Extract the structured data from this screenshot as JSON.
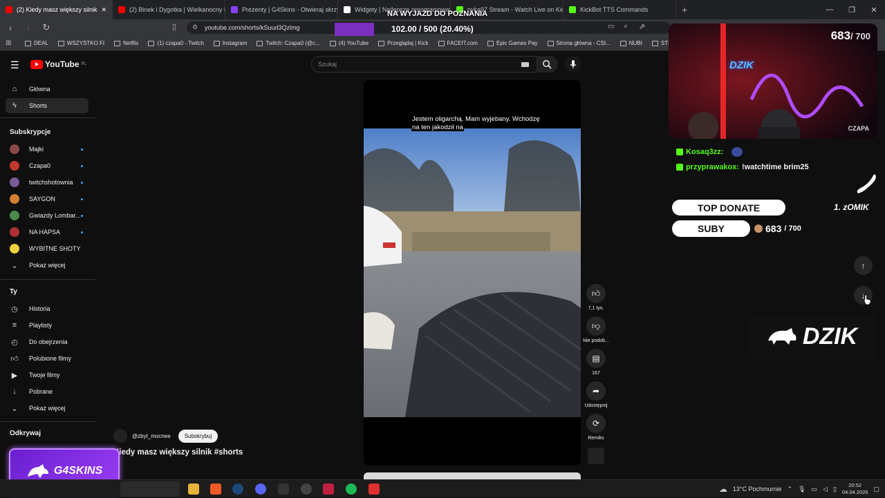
{
  "browser": {
    "tabs": [
      {
        "title": "(2) Kiedy masz większy silnik",
        "active": true,
        "color": "#ff0000"
      },
      {
        "title": "(2) Binek i Dygotka | Wielkanocny Ba",
        "color": "#ff0000"
      },
      {
        "title": "Prezenty | G4Skins - Otwieraj skrzynk",
        "color": "#8a3ffc"
      },
      {
        "title": "Widgety | Najlepsze oprogramowanie",
        "color": "#ffffff"
      },
      {
        "title": "pyka97 Stream - Watch Live on Kick",
        "color": "#53fc18"
      },
      {
        "title": "KickBot TTS Commands",
        "color": "#53fc18"
      }
    ],
    "url": "youtube.com/shorts/kSuud3Qzlmg",
    "bookmarks": [
      "DEAL",
      "WSZYSTKO FI",
      "Netflix",
      "(1) czapa0 - Twitch",
      "Instagram",
      "Twitch: Czapa0 (@c...",
      "(4) YouTube",
      "Przeglądaj | Kick",
      "FACEIT.com",
      "Epic Games Pay",
      "Strona główna - CSI...",
      "NUBI",
      "STRONY"
    ]
  },
  "youtube": {
    "logo": "YouTube",
    "logo_region": "PL",
    "search_placeholder": "Szukaj",
    "sidebar": {
      "main": [
        {
          "label": "Główna",
          "icon": "home-icon"
        },
        {
          "label": "Shorts",
          "icon": "shorts-icon",
          "selected": true
        }
      ],
      "subs_header": "Subskrypcje",
      "subs": [
        {
          "label": "Majki",
          "color": "#8b4a4a"
        },
        {
          "label": "Czapa0",
          "color": "#c0392b"
        },
        {
          "label": "twitchshotownia",
          "color": "#7a5a9a"
        },
        {
          "label": "SAYGON",
          "color": "#d08030"
        },
        {
          "label": "Gwiazdy Lombar...",
          "color": "#4a8a4a"
        },
        {
          "label": "NA HAPSA",
          "color": "#b03030"
        },
        {
          "label": "WYBITNE SHOTY",
          "color": "#f0d040"
        }
      ],
      "subs_more": "Pokaż więcej",
      "you_header": "Ty",
      "you": [
        {
          "label": "Historia",
          "icon": "history-icon"
        },
        {
          "label": "Playlisty",
          "icon": "playlist-icon"
        },
        {
          "label": "Do obejrzenia",
          "icon": "watch-later-icon"
        },
        {
          "label": "Polubione filmy",
          "icon": "like-icon"
        },
        {
          "label": "Twoje filmy",
          "icon": "your-videos-icon"
        },
        {
          "label": "Pobrane",
          "icon": "download-icon"
        }
      ],
      "you_more": "Pokaż więcej",
      "explore_header": "Odkrywaj"
    },
    "short": {
      "caption": [
        "Jestem oligarchą. Mam wyjebany. Wchodzę",
        "na ten jakodził na"
      ],
      "channel": "@zbyt_mocnee",
      "subscribe": "Subskrybuj",
      "title": "Kiedy masz większy silnik #shorts",
      "actions": [
        {
          "icon": "like-icon",
          "label": "7,1 tys."
        },
        {
          "icon": "dislike-icon",
          "label": "Nie podob..."
        },
        {
          "icon": "comment-icon",
          "label": "167"
        },
        {
          "icon": "share-icon",
          "label": "Udostępnij"
        },
        {
          "icon": "remix-icon",
          "label": "Remiks"
        }
      ]
    }
  },
  "stream_overlay": {
    "top_text": "NA WYJAZD DO POZNANIA",
    "goal_text": "102.00 / 500 (20.40%)",
    "goal_fraction": 0.204,
    "cam_sub_count": "683",
    "cam_sub_total": "/ 700",
    "cam_logo": "DZIK",
    "cam_name": "CZAPA",
    "chat": [
      {
        "user": "Kosaq3zz:",
        "msg": "",
        "color": "#53fc18"
      },
      {
        "user": "przyprawakox:",
        "msg": "!watchtime brim25",
        "color": "#53fc18"
      }
    ],
    "top_donate_label": "TOP DONATE",
    "top_donate_value": "1. zOMIK",
    "suby_label": "SUBY",
    "suby_count": "683",
    "suby_total": "/ 700",
    "dzik_banner": "DZIK",
    "g4skins_banner": "G4SKINS"
  },
  "taskbar": {
    "weather": "13°C  Pochmurnie",
    "time": "20:52",
    "date": "04.04.2026"
  }
}
